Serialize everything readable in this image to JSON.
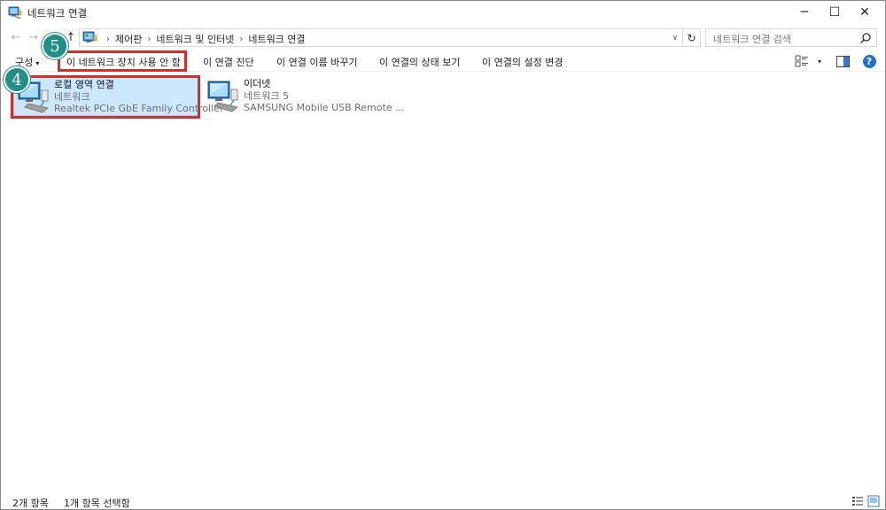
{
  "window": {
    "title": "네트워크 연결",
    "minimize_glyph": "─",
    "maximize_glyph": "☐",
    "close_glyph": "✕"
  },
  "address": {
    "back_glyph": "←",
    "forward_glyph": "→",
    "up_glyph": "↑",
    "crumbs": [
      "제어판",
      "네트워크 및 인터넷",
      "네트워크 연결"
    ],
    "separator": "›",
    "dropdown_glyph": "∨",
    "refresh_glyph": "↻",
    "search_placeholder": "네트워크 연결 검색"
  },
  "commandbar": {
    "organize": "구성",
    "organize_caret": "▾",
    "disable": "이 네트워크 장치 사용 안 함",
    "diagnose": "이 연결 진단",
    "rename": "이 연결 이름 바꾸기",
    "status": "이 연결의 상태 보기",
    "settings": "이 연결의 설정 변경",
    "view_caret": "▾",
    "help": "?"
  },
  "items": [
    {
      "name": "로컬 영역 연결",
      "network": "네트워크",
      "adapter": "Realtek PCIe GbE Family Controller",
      "selected": true
    },
    {
      "name": "이더넷",
      "network": "네트워크 5",
      "adapter": "SAMSUNG Mobile USB Remote ...",
      "selected": false
    }
  ],
  "callouts": {
    "step_disable": "5",
    "step_item": "4",
    "color": "#1f8f87"
  },
  "highlight_color": "#d32e2e",
  "selection_color": "#cce8ff",
  "statusbar": {
    "count": "2개 항목",
    "selected": "1개 항목 선택함"
  },
  "icons": {
    "title": "network-connections-icon",
    "address": "control-panel-icon",
    "search": "search-icon",
    "item": "network-adapter-icon",
    "view": "change-view-icon",
    "preview": "preview-pane-icon",
    "help": "help-icon"
  }
}
